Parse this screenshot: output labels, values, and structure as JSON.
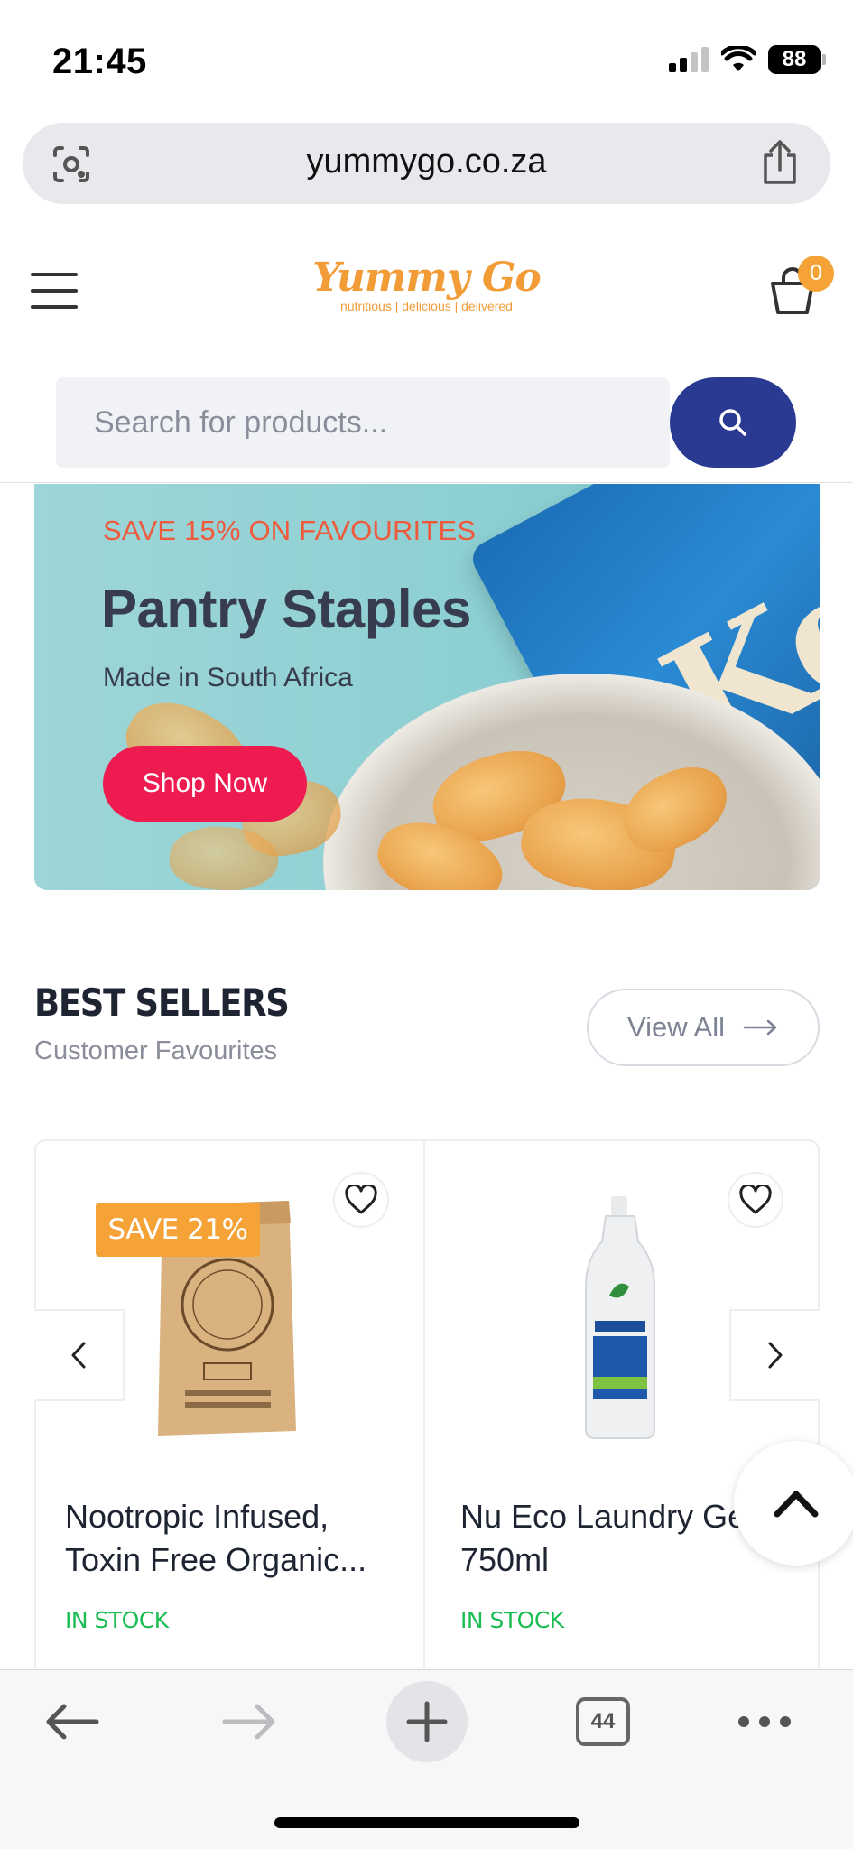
{
  "status_bar": {
    "time": "21:45",
    "battery": "88"
  },
  "url_bar": {
    "url": "yummygo.co.za"
  },
  "header": {
    "logo_name": "Yummy Go",
    "logo_tagline": "nutritious | delicious | delivered",
    "cart_count": "0"
  },
  "search": {
    "placeholder": "Search for products..."
  },
  "banner": {
    "eyebrow": "SAVE 15% ON FAVOURITES",
    "title": "Pantry Staples",
    "subtitle": "Made in South Africa",
    "cta_label": "Shop Now",
    "bag_text": "Ket"
  },
  "best_sellers": {
    "title": "BEST SELLERS",
    "subtitle": "Customer Favourites",
    "view_all_label": "View All",
    "products": [
      {
        "name": "Nootropic Infused, Toxin Free Organic...",
        "stock": "IN STOCK",
        "badge": "SAVE 21%"
      },
      {
        "name": "Nu Eco Laundry Gel 750ml",
        "stock": "IN STOCK"
      }
    ]
  },
  "toolbar": {
    "tab_count": "44"
  },
  "colors": {
    "accent": "#2a3a92",
    "brand_orange": "#f29c38",
    "cta_red": "#ee1b50",
    "stock_green": "#1bbd52"
  },
  "icons": [
    "screenshot-lens-icon",
    "share-icon",
    "menu-icon",
    "cart-icon",
    "search-icon",
    "heart-icon",
    "chevron-left-icon",
    "chevron-right-icon",
    "chevron-up-icon",
    "back-arrow-icon",
    "forward-arrow-icon",
    "plus-icon",
    "more-icon"
  ]
}
